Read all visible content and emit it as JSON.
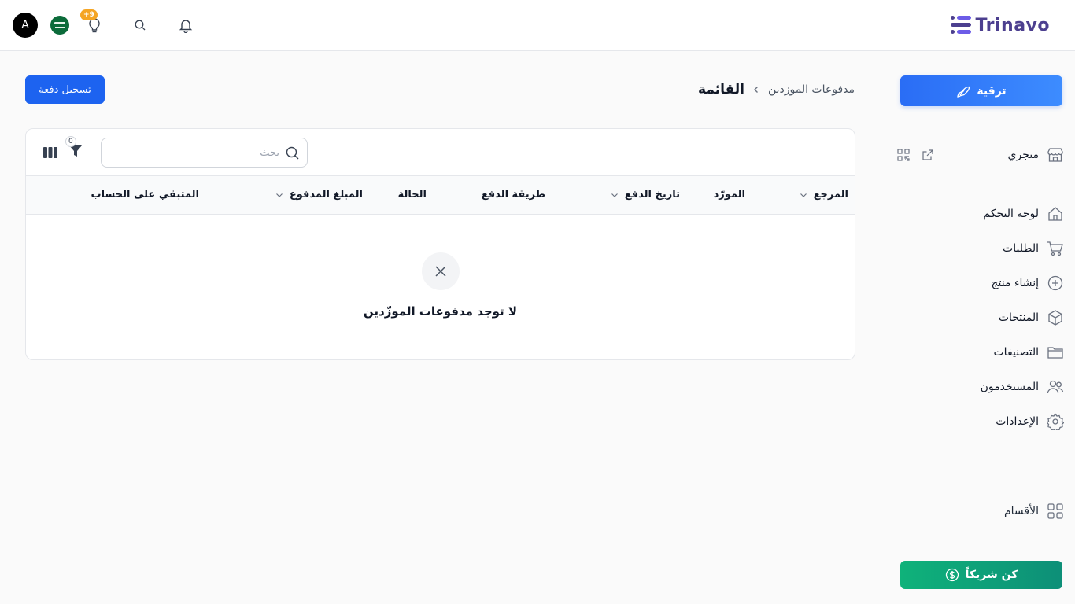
{
  "header": {
    "logo_text": "Trinavo",
    "avatar_initial": "A",
    "notifications_badge": "+9"
  },
  "sidebar": {
    "upgrade_label": "ترقية",
    "store_label": "متجري",
    "items": [
      {
        "label": "لوحة التحكم",
        "icon": "home-icon"
      },
      {
        "label": "الطلبات",
        "icon": "cart-icon"
      },
      {
        "label": "إنشاء منتج",
        "icon": "plus-circle-icon"
      },
      {
        "label": "المنتجات",
        "icon": "box-icon"
      },
      {
        "label": "التصنيفات",
        "icon": "folder-icon"
      },
      {
        "label": "المستخدمون",
        "icon": "users-icon"
      },
      {
        "label": "الإعدادات",
        "icon": "gear-icon"
      }
    ],
    "sections_label": "الأقسام",
    "partner_label": "كن شريكاً"
  },
  "breadcrumb": {
    "parent": "مدفوعات الموزدين",
    "current": "القائمة"
  },
  "actions": {
    "register_payment": "تسجيل دفعة"
  },
  "table": {
    "search_placeholder": "بحث",
    "filter_count": "0",
    "columns": [
      {
        "label": "المرجع",
        "sortable": true
      },
      {
        "label": "المورّد",
        "sortable": false
      },
      {
        "label": "تاريخ الدفع",
        "sortable": true
      },
      {
        "label": "طريقة الدفع",
        "sortable": false
      },
      {
        "label": "الحالة",
        "sortable": false
      },
      {
        "label": "المبلغ المدفوع",
        "sortable": true
      },
      {
        "label": "المتبقي على الحساب",
        "sortable": false
      }
    ],
    "empty_message": "لا توجد مدفوعات الموزّدين"
  },
  "colors": {
    "primary": "#1d63f0",
    "upgrade_gradient": "#2a6df5",
    "partner_gradient": "#0fb27a",
    "logo": "#4c3f8f",
    "badge": "#f5a524"
  }
}
